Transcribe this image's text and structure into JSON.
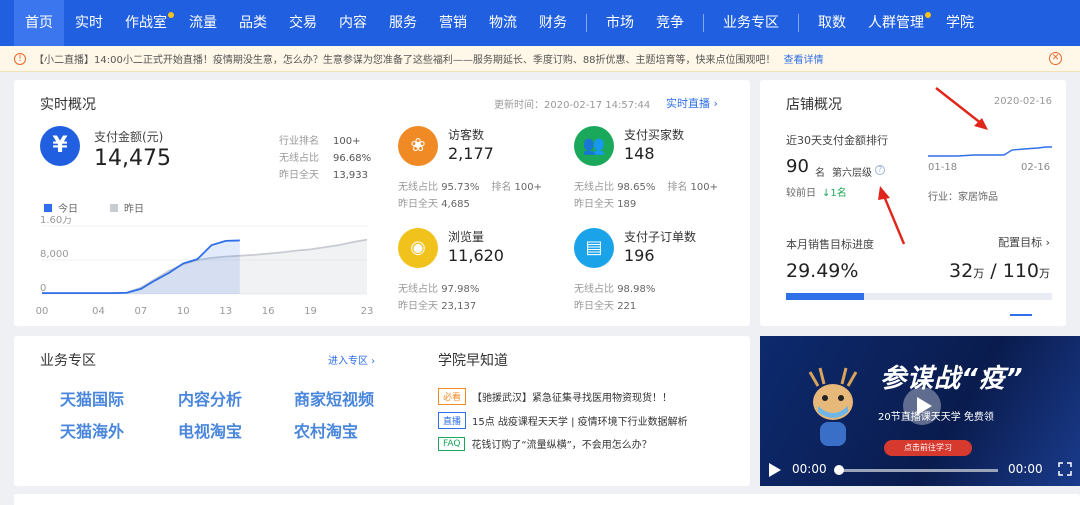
{
  "nav": {
    "items": [
      {
        "label": "首页",
        "active": true,
        "dot": false
      },
      {
        "label": "实时",
        "active": false,
        "dot": false
      },
      {
        "label": "作战室",
        "active": false,
        "dot": true
      },
      {
        "label": "流量",
        "active": false,
        "dot": false
      },
      {
        "label": "品类",
        "active": false,
        "dot": false
      },
      {
        "label": "交易",
        "active": false,
        "dot": false
      },
      {
        "label": "内容",
        "active": false,
        "dot": false
      },
      {
        "label": "服务",
        "active": false,
        "dot": false
      },
      {
        "label": "营销",
        "active": false,
        "dot": false
      },
      {
        "label": "物流",
        "active": false,
        "dot": false
      },
      {
        "label": "财务",
        "active": false,
        "dot": false
      },
      {
        "label": "市场",
        "active": false,
        "dot": false
      },
      {
        "label": "竞争",
        "active": false,
        "dot": false
      },
      {
        "label": "业务专区",
        "active": false,
        "dot": false
      },
      {
        "label": "取数",
        "active": false,
        "dot": false
      },
      {
        "label": "人群管理",
        "active": false,
        "dot": true
      },
      {
        "label": "学院",
        "active": false,
        "dot": false
      }
    ]
  },
  "notice": {
    "text": "【小二直播】14:00小二正式开始直播！疫情期没生意，怎么办？生意参谋为您准备了这些福利——服务期延长、季度订购、88折优惠、主题培育等，快来点位围观吧！",
    "link": "查看详情"
  },
  "realtime": {
    "title": "实时概况",
    "update_time": "更新时间：2020-02-17 14:57:44",
    "live_link": "实时直播",
    "pay": {
      "icon": "yen-icon",
      "label": "支付金额(元)",
      "value": "14,475",
      "industry_rank_label": "行业排名",
      "industry_rank": "100+",
      "wireless_label": "无线占比",
      "wireless": "96.68%",
      "yesterday_label": "昨日全天",
      "yesterday": "13,933"
    },
    "legend": {
      "today": "今日",
      "yesterday": "昨日"
    },
    "metrics": [
      {
        "icon": "paw-icon",
        "color": "#f08a24",
        "label": "访客数",
        "value": "2,177",
        "wireless_label": "无线占比",
        "wireless": "95.73%",
        "rank_label": "排名",
        "rank": "100+",
        "yesterday_label": "昨日全天",
        "yesterday": "4,685"
      },
      {
        "icon": "buyers-icon",
        "color": "#1aa85a",
        "label": "支付买家数",
        "value": "148",
        "wireless_label": "无线占比",
        "wireless": "98.65%",
        "rank_label": "排名",
        "rank": "100+",
        "yesterday_label": "昨日全天",
        "yesterday": "189"
      },
      {
        "icon": "eye-icon",
        "color": "#f2c21c",
        "label": "浏览量",
        "value": "11,620",
        "wireless_label": "无线占比",
        "wireless": "97.98%",
        "rank_label": "",
        "rank": "",
        "yesterday_label": "昨日全天",
        "yesterday": "23,137"
      },
      {
        "icon": "order-icon",
        "color": "#1aa3e8",
        "label": "支付子订单数",
        "value": "196",
        "wireless_label": "无线占比",
        "wireless": "98.98%",
        "rank_label": "",
        "rank": "",
        "yesterday_label": "昨日全天",
        "yesterday": "221"
      }
    ]
  },
  "chart_data": {
    "type": "area",
    "x_ticks": [
      "00",
      "04",
      "07",
      "10",
      "13",
      "16",
      "19",
      "23"
    ],
    "y_ticks": [
      "0",
      "8,000",
      "1.60万"
    ],
    "ylim": [
      0,
      16000
    ],
    "xlim": [
      0,
      23
    ],
    "series": [
      {
        "name": "今日",
        "color": "#2f6fe8",
        "x": [
          0,
          1,
          2,
          3,
          4,
          5,
          6,
          7,
          8,
          9,
          10,
          11,
          12,
          13,
          14
        ],
        "y": [
          200,
          200,
          200,
          200,
          200,
          200,
          300,
          1200,
          3200,
          5000,
          7200,
          8200,
          11500,
          12500,
          12600
        ]
      },
      {
        "name": "昨日",
        "color": "#c8cbd2",
        "x": [
          0,
          1,
          2,
          3,
          4,
          5,
          6,
          7,
          8,
          9,
          10,
          11,
          12,
          13,
          14,
          15,
          16,
          17,
          18,
          19,
          20,
          21,
          22,
          23
        ],
        "y": [
          200,
          200,
          200,
          200,
          200,
          200,
          300,
          1500,
          3500,
          5500,
          7000,
          8000,
          8500,
          8800,
          9000,
          9200,
          9500,
          9800,
          10200,
          10500,
          11000,
          11500,
          12200,
          12800
        ]
      }
    ]
  },
  "store": {
    "title": "店铺概况",
    "date": "2020-02-16",
    "rank_label": "近30天支付金额排行",
    "rank": "90",
    "rank_unit": "名",
    "level": "第六层级",
    "compare_label": "较前日",
    "compare_value": "↓1名",
    "mini_x_start": "01-18",
    "mini_x_end": "02-16",
    "industry": "行业：家居饰品",
    "target_label": "本月销售目标进度",
    "target_config": "配置目标",
    "target_pct": "29.49%",
    "target_progress": 0.2949,
    "target_current": "32",
    "target_total": "110",
    "target_unit": "万",
    "target_sep": "/"
  },
  "biz": {
    "title": "业务专区",
    "more": "进入专区",
    "links": [
      "天猫国际",
      "内容分析",
      "商家短视频",
      "天猫海外",
      "电视淘宝",
      "农村淘宝"
    ]
  },
  "academy": {
    "title": "学院早知道",
    "items": [
      {
        "tag": "必看",
        "tag_color": "#f08a24",
        "text": "【驰援武汉】紧急征集寻找医用物资现货！！"
      },
      {
        "tag": "直播",
        "tag_color": "#2f6fe8",
        "text": "15点 战疫课程天天学 | 疫情环境下行业数据解析"
      },
      {
        "tag": "FAQ",
        "tag_color": "#1aa85a",
        "text": "花钱订购了“流量纵横”，不会用怎么办？"
      }
    ]
  },
  "video": {
    "title": "参谋战“疫”",
    "subtitle": "20节直播课天天学 免费领",
    "cta": "点击前往学习",
    "time_current": "00:00",
    "time_total": "00:00"
  }
}
